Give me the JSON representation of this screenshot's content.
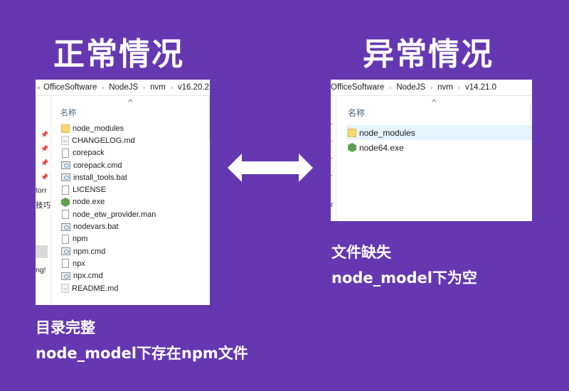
{
  "left": {
    "title": "正常情况",
    "breadcrumb": [
      "OfficeSoftware",
      "NodeJS",
      "nvm",
      "v16.20.2"
    ],
    "breadcrumb_lead": "«",
    "column_header": "名称",
    "sidebar_fragments": [
      "torr",
      "技巧",
      "ng!"
    ],
    "files": [
      {
        "name": "node_modules",
        "icon": "folder-icon"
      },
      {
        "name": "CHANGELOG.md",
        "icon": "markdown-file-icon"
      },
      {
        "name": "corepack",
        "icon": "file-icon"
      },
      {
        "name": "corepack.cmd",
        "icon": "batch-file-icon"
      },
      {
        "name": "install_tools.bat",
        "icon": "batch-file-icon"
      },
      {
        "name": "LICENSE",
        "icon": "file-icon"
      },
      {
        "name": "node.exe",
        "icon": "nodejs-icon"
      },
      {
        "name": "node_etw_provider.man",
        "icon": "file-icon"
      },
      {
        "name": "nodevars.bat",
        "icon": "batch-file-icon"
      },
      {
        "name": "npm",
        "icon": "file-icon"
      },
      {
        "name": "npm.cmd",
        "icon": "batch-file-icon"
      },
      {
        "name": "npx",
        "icon": "file-icon"
      },
      {
        "name": "npx.cmd",
        "icon": "batch-file-icon"
      },
      {
        "name": "README.md",
        "icon": "markdown-file-icon"
      }
    ],
    "caption_line1": "目录完整",
    "caption_line2": "node_model下存在npm文件"
  },
  "right": {
    "title": "异常情况",
    "breadcrumb": [
      "OfficeSoftware",
      "NodeJS",
      "nvm",
      "v14.21.0"
    ],
    "column_header": "名称",
    "sidebar_fragments": [
      "r"
    ],
    "files": [
      {
        "name": "node_modules",
        "icon": "folder-icon",
        "selected": true
      },
      {
        "name": "node64.exe",
        "icon": "nodejs-icon"
      }
    ],
    "caption_line1": "文件缺失",
    "caption_line2": "node_model下为空"
  },
  "arrow": {
    "icon": "double-arrow-icon"
  },
  "colors": {
    "background": "#6538b1",
    "selection": "#e5f3fd",
    "node_green": "#5fa04e",
    "folder": "#f8d775"
  }
}
